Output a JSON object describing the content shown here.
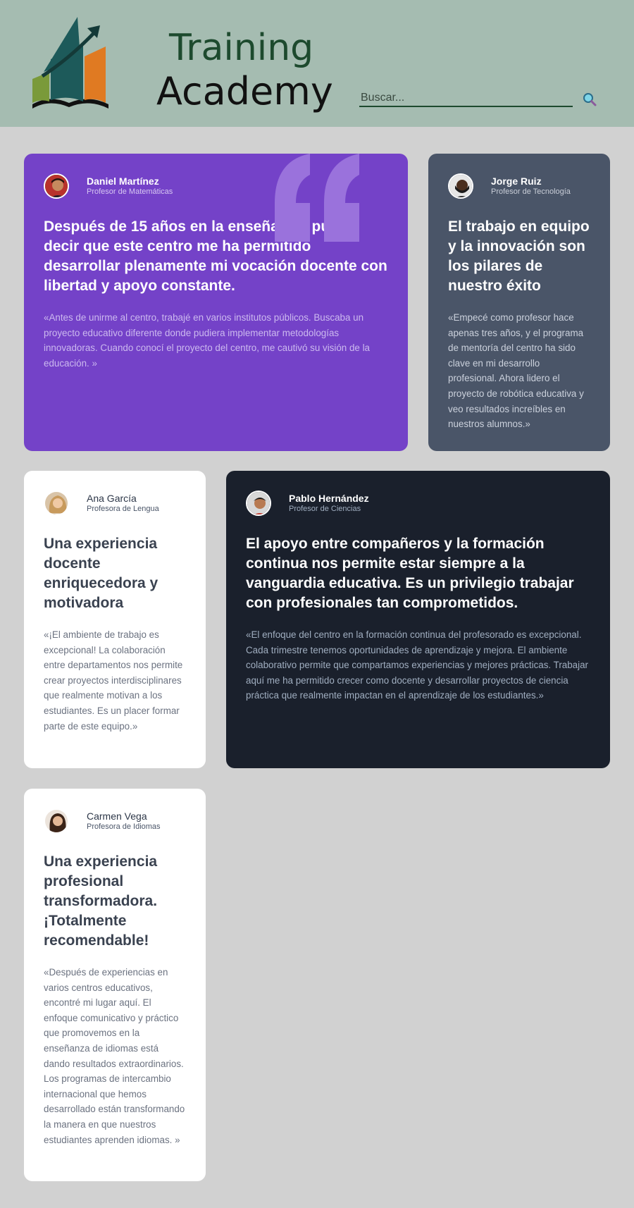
{
  "header": {
    "brand_line1": "Training",
    "brand_line2": "Academy",
    "search_placeholder": "Buscar...",
    "search_icon": "search-icon"
  },
  "colors": {
    "header_bg": "#a5bcb1",
    "page_bg": "#d1d1d1",
    "purple": "#7442c8",
    "slate": "#4a5568",
    "dark": "#1a202c",
    "brand_green": "#1d4a2e"
  },
  "testimonials": [
    {
      "name": "Daniel Martínez",
      "role": "Profesor de Matemáticas",
      "headline": "Después de 15 años en la enseñanza, puedo decir que este centro me ha permitido desarrollar plenamente mi vocación docente con libertad y apoyo constante.",
      "body": "«Antes de unirme al centro, trabajé en varios institutos públicos. Buscaba un proyecto educativo diferente donde pudiera implementar metodologías innovadoras. Cuando conocí el proyecto del centro, me cautivó su visión de la educación. »"
    },
    {
      "name": "Jorge Ruiz",
      "role": "Profesor de Tecnología",
      "headline": "El trabajo en equipo y la innovación son los pilares de nuestro éxito",
      "body": "«Empecé como profesor hace apenas tres años, y el programa de mentoría del centro ha sido clave en mi desarrollo profesional. Ahora lidero el proyecto de robótica educativa y veo resultados increíbles en nuestros alumnos.»"
    },
    {
      "name": "Ana García",
      "role": "Profesora de Lengua",
      "headline": "Una experiencia docente enriquecedora y motivadora",
      "body": "«¡El ambiente de trabajo es excepcional! La colaboración entre departamentos nos permite crear proyectos interdisciplinares que realmente motivan a los estudiantes. Es un placer formar parte de este equipo.»"
    },
    {
      "name": "Pablo Hernández",
      "role": "Profesor de Ciencias",
      "headline": "El apoyo entre compañeros y la formación continua nos permite estar siempre a la vanguardia educativa. Es un privilegio trabajar con profesionales tan comprometidos.",
      "body": "«El enfoque del centro en la formación continua del profesorado es excepcional. Cada trimestre tenemos oportunidades de aprendizaje y mejora. El ambiente colaborativo permite que compartamos experiencias y mejores prácticas. Trabajar aquí me ha permitido crecer como docente y desarrollar proyectos de ciencia práctica que realmente impactan en el aprendizaje de los estudiantes.»"
    },
    {
      "name": "Carmen Vega",
      "role": "Profesora de Idiomas",
      "headline": "Una experiencia profesional transformadora. ¡Totalmente recomendable!",
      "body": "«Después de experiencias en varios centros educativos, encontré mi lugar aquí. El enfoque comunicativo y práctico que promovemos en la enseñanza de idiomas está dando resultados extraordinarios. Los programas de intercambio internacional que hemos desarrollado están transformando la manera en que nuestros estudiantes aprenden idiomas. »"
    }
  ]
}
